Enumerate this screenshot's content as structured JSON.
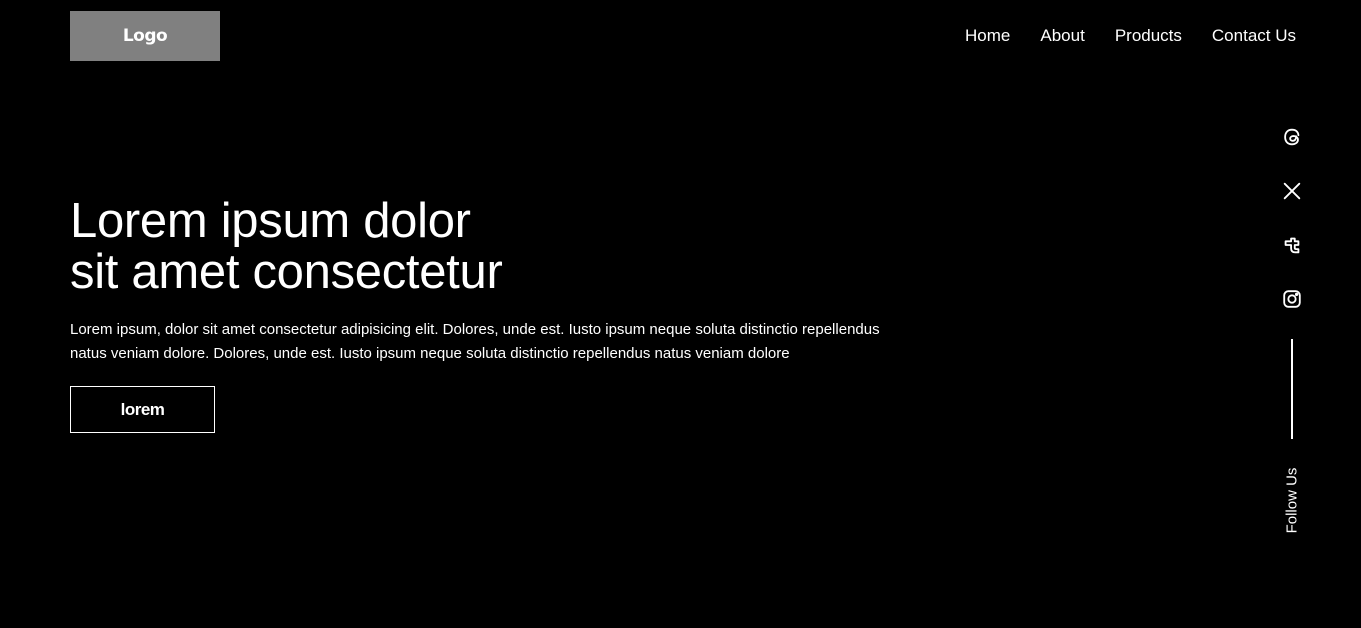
{
  "header": {
    "logo_text": "Logo",
    "nav": [
      {
        "label": "Home"
      },
      {
        "label": "About"
      },
      {
        "label": "Products"
      },
      {
        "label": "Contact Us"
      }
    ]
  },
  "hero": {
    "title_line1": "Lorem ipsum dolor",
    "title_line2": "sit amet consectetur",
    "description": "Lorem ipsum, dolor sit amet consectetur adipisicing elit. Dolores, unde est. Iusto ipsum neque soluta distinctio repellendus natus veniam dolore. Dolores, unde est. Iusto ipsum neque soluta distinctio repellendus natus veniam dolore",
    "button_label": "lorem"
  },
  "social": {
    "icons": [
      "threads-icon",
      "x-icon",
      "tumblr-icon",
      "instagram-icon"
    ],
    "follow_label": "Follow Us"
  },
  "colors": {
    "background": "#000000",
    "logo_bg": "#808080",
    "text": "#ffffff"
  }
}
